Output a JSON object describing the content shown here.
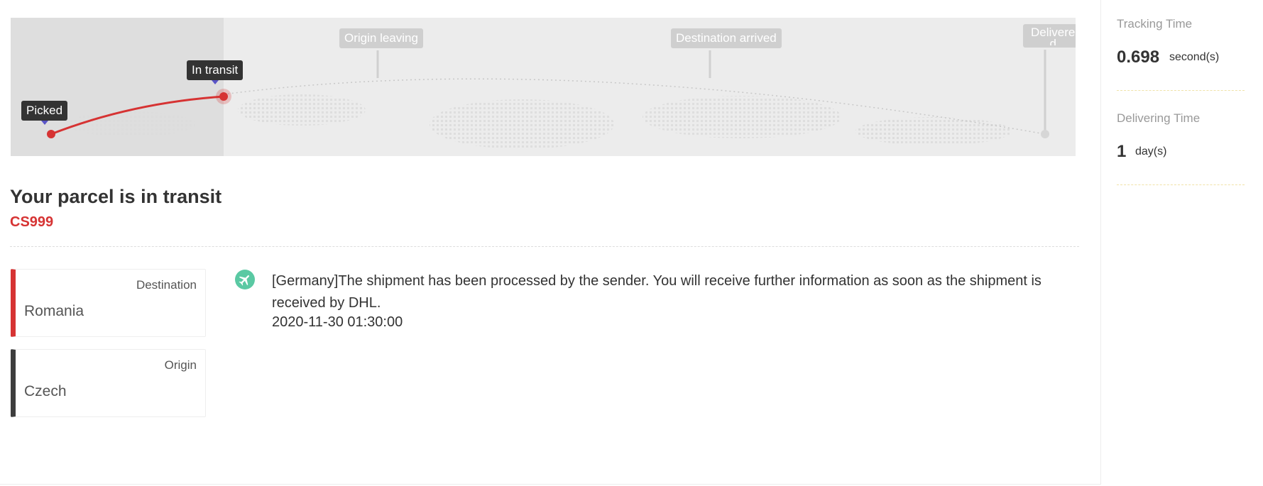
{
  "progress": {
    "stages": [
      "Picked",
      "In transit",
      "Origin leaving",
      "Destination arrived",
      "Delivered"
    ],
    "stage_line_1": "Delivere",
    "stage_line_2": "d",
    "current_stage": "In transit",
    "accent_color": "#d63333",
    "marker_color": "#5a55c7"
  },
  "parcel": {
    "status_title": "Your parcel is in transit",
    "tracking_number": "CS999"
  },
  "destination": {
    "label": "Destination",
    "value": "Romania"
  },
  "origin": {
    "label": "Origin",
    "value": "Czech"
  },
  "events": [
    {
      "icon": "airplane-icon",
      "text": "[Germany]The shipment has been processed by the sender. You will receive further information as soon as the shipment is received by DHL.",
      "time": "2020-11-30 01:30:00"
    }
  ],
  "stats": {
    "tracking_time": {
      "label": "Tracking Time",
      "value": "0.698",
      "unit": "second(s)"
    },
    "delivering_time": {
      "label": "Delivering Time",
      "value": "1",
      "unit": "day(s)"
    }
  }
}
